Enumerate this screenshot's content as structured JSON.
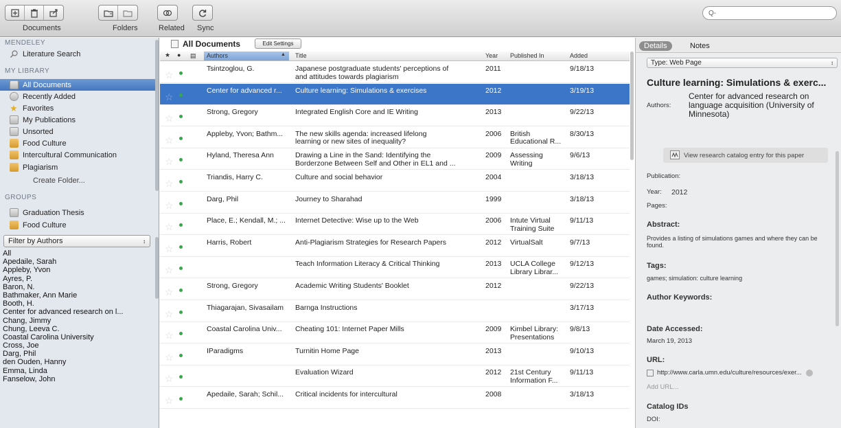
{
  "toolbar": {
    "documents_label": "Documents",
    "folders_label": "Folders",
    "related_label": "Related",
    "sync_label": "Sync",
    "search_placeholder": "Q-"
  },
  "sidebar": {
    "mendeley_header": "MENDELEY",
    "literature_search": "Literature Search",
    "library_header": "MY LIBRARY",
    "library_items": [
      {
        "label": "All Documents",
        "icon": "document-icon",
        "selected": true
      },
      {
        "label": "Recently Added",
        "icon": "clock-icon",
        "selected": false
      },
      {
        "label": "Favorites",
        "icon": "star-icon",
        "selected": false
      },
      {
        "label": "My Publications",
        "icon": "person-icon",
        "selected": false
      },
      {
        "label": "Unsorted",
        "icon": "tray-icon",
        "selected": false
      },
      {
        "label": "Food Culture",
        "icon": "folder-icon",
        "selected": false
      },
      {
        "label": "Intercultural Communication",
        "icon": "folder-icon",
        "selected": false
      },
      {
        "label": "Plagiarism",
        "icon": "folder-icon",
        "selected": false
      }
    ],
    "create_folder": "Create Folder...",
    "groups_header": "GROUPS",
    "group_items": [
      {
        "label": "Graduation Thesis",
        "icon": "group-icon"
      },
      {
        "label": "Food Culture",
        "icon": "group-folder-icon"
      }
    ],
    "filter_label": "Filter by Authors",
    "authors": [
      "All",
      "Apedaile, Sarah",
      "Appleby, Yvon",
      "Ayres, P.",
      "Baron, N.",
      "Bathmaker, Ann Marie",
      "Booth, H.",
      "Center for advanced research on l...",
      "Chang, Jimmy",
      "Chung, Leeva C.",
      "Coastal Carolina University",
      "Cross, Joe",
      "Darg, Phil",
      "den Ouden, Hanny",
      "Emma, Linda",
      "Fanselow, John"
    ]
  },
  "main": {
    "title": "All Documents",
    "edit_settings": "Edit Settings",
    "columns": {
      "authors": "Authors",
      "title": "Title",
      "year": "Year",
      "published": "Published In",
      "added": "Added"
    },
    "rows": [
      {
        "authors": "Tsintzoglou, G.",
        "title": [
          "Japanese postgraduate students' perceptions of",
          "and attitudes towards plagiarism"
        ],
        "year": "2011",
        "published": [
          "",
          ""
        ],
        "added": "9/18/13",
        "dot": true
      },
      {
        "authors": "Center for advanced r...",
        "title": [
          "Culture learning: Simulations & exercises",
          ""
        ],
        "year": "2012",
        "published": [
          "",
          ""
        ],
        "added": "3/19/13",
        "dot": true,
        "selected": true
      },
      {
        "authors": "Strong, Gregory",
        "title": [
          "Integrated English Core and IE Writing",
          ""
        ],
        "year": "2013",
        "published": [
          "",
          ""
        ],
        "added": "9/22/13",
        "dot": true
      },
      {
        "authors": "Appleby, Yvon; Bathm...",
        "title": [
          "The new skills agenda: increased lifelong",
          "learning or new sites of inequality?"
        ],
        "year": "2006",
        "published": [
          "British",
          "Educational R..."
        ],
        "added": "8/30/13",
        "dot": true
      },
      {
        "authors": "Hyland, Theresa Ann",
        "title": [
          "Drawing a Line in the Sand: Identifying the",
          "Borderzone Between Self and Other in EL1 and ..."
        ],
        "year": "2009",
        "published": [
          "Assessing",
          "Writing"
        ],
        "added": "9/6/13",
        "dot": true
      },
      {
        "authors": "Triandis, Harry C.",
        "title": [
          "Culture and social behavior",
          ""
        ],
        "year": "2004",
        "published": [
          "",
          ""
        ],
        "added": "3/18/13",
        "dot": true
      },
      {
        "authors": "Darg, Phil",
        "title": [
          "Journey to Sharahad",
          ""
        ],
        "year": "1999",
        "published": [
          "",
          ""
        ],
        "added": "3/18/13",
        "dot": true
      },
      {
        "authors": "Place, E.; Kendall, M.; ...",
        "title": [
          "Internet Detective: Wise up to the Web",
          ""
        ],
        "year": "2006",
        "published": [
          "Intute Virtual",
          "Training Suite"
        ],
        "added": "9/11/13",
        "dot": true
      },
      {
        "authors": "Harris, Robert",
        "title": [
          "Anti-Plagiarism Strategies for Research Papers",
          ""
        ],
        "year": "2012",
        "published": [
          "VirtualSalt",
          ""
        ],
        "added": "9/7/13",
        "dot": true
      },
      {
        "authors": "",
        "title": [
          "Teach Information Literacy & Critical Thinking",
          ""
        ],
        "year": "2013",
        "published": [
          "UCLA College",
          "Library Librar..."
        ],
        "added": "9/12/13",
        "dot": true
      },
      {
        "authors": "Strong, Gregory",
        "title": [
          "Academic Writing Students' Booklet",
          ""
        ],
        "year": "2012",
        "published": [
          "",
          ""
        ],
        "added": "9/22/13",
        "dot": true
      },
      {
        "authors": "Thiagarajan, Sivasailam",
        "title": [
          "Barnga Instructions",
          ""
        ],
        "year": "",
        "published": [
          "",
          ""
        ],
        "added": "3/17/13",
        "dot": true
      },
      {
        "authors": "Coastal Carolina Univ...",
        "title": [
          "Cheating 101: Internet Paper Mills",
          ""
        ],
        "year": "2009",
        "published": [
          "Kimbel Library:",
          "Presentations"
        ],
        "added": "9/8/13",
        "dot": true
      },
      {
        "authors": "IParadigms",
        "title": [
          "Turnitin Home Page",
          ""
        ],
        "year": "2013",
        "published": [
          "",
          ""
        ],
        "added": "9/10/13",
        "dot": true
      },
      {
        "authors": "",
        "title": [
          "Evaluation Wizard",
          ""
        ],
        "year": "2012",
        "published": [
          "21st Century",
          "Information F..."
        ],
        "added": "9/11/13",
        "dot": true
      },
      {
        "authors": "Apedaile, Sarah; Schil...",
        "title": [
          "Critical incidents for intercultural",
          ""
        ],
        "year": "2008",
        "published": [
          "",
          ""
        ],
        "added": "3/18/13",
        "dot": true
      }
    ]
  },
  "details": {
    "tab_details": "Details",
    "tab_notes": "Notes",
    "type_label": "Type:",
    "type_value": "Web Page",
    "title": "Culture learning: Simulations & exerc...",
    "authors_label": "Authors:",
    "authors_value": "Center for advanced research on language acquisition (University of Minnesota)",
    "catalog_button": "View research catalog entry for this paper",
    "publication_label": "Publication:",
    "year_label": "Year:",
    "year_value": "2012",
    "pages_label": "Pages:",
    "abstract_header": "Abstract:",
    "abstract_text": "Provides a listing of simulations games and where they can be found.",
    "tags_header": "Tags:",
    "tags_value": "games; simulation: culture learning",
    "keywords_header": "Author Keywords:",
    "date_accessed_header": "Date Accessed:",
    "date_accessed_value": "March 19, 2013",
    "url_header": "URL:",
    "url_value": "http://www.carla.umn.edu/culture/resources/exer...",
    "add_url": "Add URL...",
    "catalog_ids_header": "Catalog IDs",
    "doi_label": "DOI:"
  }
}
